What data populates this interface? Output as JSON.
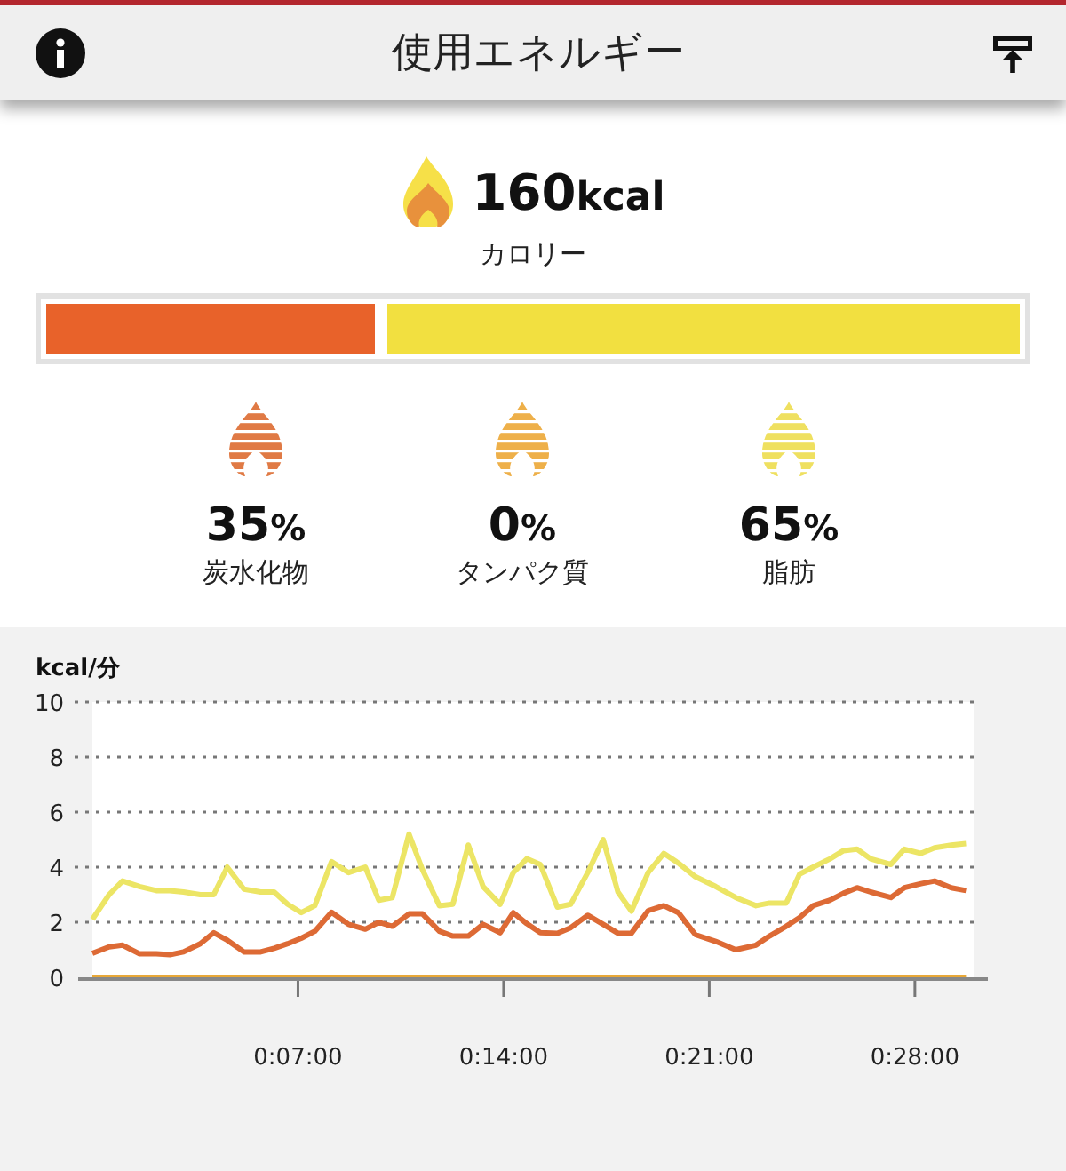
{
  "header": {
    "title": "使用エネルギー"
  },
  "calories": {
    "value": "160",
    "unit": "kcal",
    "label": "カロリー"
  },
  "bar": {
    "level": 0.35
  },
  "macros": [
    {
      "value": "35",
      "unit": "%",
      "label": "炭水化物",
      "color": "#e07a45"
    },
    {
      "value": "0",
      "unit": "%",
      "label": "タンパク質",
      "color": "#eeb04a"
    },
    {
      "value": "65",
      "unit": "%",
      "label": "脂肪",
      "color": "#efe060"
    }
  ],
  "chart": {
    "chart_data": {
      "type": "line",
      "grid": true,
      "ylabel": "kcal/分",
      "xlim": [
        0,
        30
      ],
      "ylim": [
        0,
        10
      ],
      "yticks": [
        0,
        2,
        4,
        6,
        8,
        10
      ],
      "xticks": [
        {
          "value": 7,
          "label": "0:07:00"
        },
        {
          "value": 14,
          "label": "0:14:00"
        },
        {
          "value": 21,
          "label": "0:21:00"
        },
        {
          "value": 28,
          "label": "0:28:00"
        }
      ],
      "x": [
        0,
        0.57,
        1.03,
        1.61,
        2.18,
        2.64,
        3.1,
        3.67,
        4.13,
        4.59,
        5.16,
        5.73,
        6.19,
        6.65,
        7.11,
        7.57,
        8.14,
        8.72,
        9.29,
        9.75,
        10.21,
        10.78,
        11.24,
        11.81,
        12.27,
        12.8,
        13.3,
        13.88,
        14.33,
        14.79,
        15.25,
        15.83,
        16.28,
        16.86,
        17.39,
        17.89,
        18.35,
        18.92,
        19.45,
        19.95,
        20.53,
        21.22,
        21.9,
        22.59,
        23.05,
        23.62,
        24.08,
        24.54,
        25.11,
        25.57,
        26.03,
        26.49,
        27.18,
        27.64,
        28.21,
        28.67,
        29.24,
        29.74
      ],
      "series": [
        {
          "color": "#ece565",
          "values": [
            2.1,
            3.0,
            3.5,
            3.3,
            3.15,
            3.15,
            3.1,
            3.0,
            3.0,
            4.0,
            3.2,
            3.1,
            3.1,
            2.65,
            2.35,
            2.6,
            4.2,
            3.8,
            4.0,
            2.8,
            2.9,
            5.2,
            3.9,
            2.6,
            2.65,
            4.8,
            3.3,
            2.65,
            3.8,
            4.3,
            4.1,
            2.55,
            2.65,
            3.8,
            5.0,
            3.1,
            2.4,
            3.8,
            4.5,
            4.15,
            3.65,
            3.3,
            2.9,
            2.6,
            2.7,
            2.7,
            3.75,
            4.0,
            4.3,
            4.6,
            4.65,
            4.3,
            4.1,
            4.65,
            4.5,
            4.7,
            4.8,
            4.85
          ]
        },
        {
          "color": "#dd6a35",
          "values": [
            0.87,
            1.1,
            1.17,
            0.85,
            0.85,
            0.82,
            0.92,
            1.22,
            1.62,
            1.35,
            0.92,
            0.92,
            1.05,
            1.22,
            1.42,
            1.67,
            2.36,
            1.92,
            1.75,
            2.0,
            1.85,
            2.3,
            2.3,
            1.67,
            1.5,
            1.5,
            1.92,
            1.62,
            2.35,
            1.95,
            1.62,
            1.6,
            1.8,
            2.25,
            1.92,
            1.6,
            1.6,
            2.42,
            2.6,
            2.35,
            1.55,
            1.3,
            1.0,
            1.17,
            1.5,
            1.85,
            2.17,
            2.6,
            2.8,
            3.05,
            3.25,
            3.1,
            2.9,
            3.25,
            3.4,
            3.5,
            3.25,
            3.15
          ]
        },
        {
          "color": "#e8a838",
          "values": [
            0,
            0,
            0,
            0,
            0,
            0,
            0,
            0,
            0,
            0,
            0,
            0,
            0,
            0,
            0,
            0,
            0,
            0,
            0,
            0,
            0,
            0,
            0,
            0,
            0,
            0,
            0,
            0,
            0,
            0,
            0,
            0,
            0,
            0,
            0,
            0,
            0,
            0,
            0,
            0,
            0,
            0,
            0,
            0,
            0,
            0,
            0,
            0,
            0,
            0,
            0,
            0,
            0,
            0,
            0,
            0,
            0,
            0
          ]
        }
      ]
    }
  }
}
